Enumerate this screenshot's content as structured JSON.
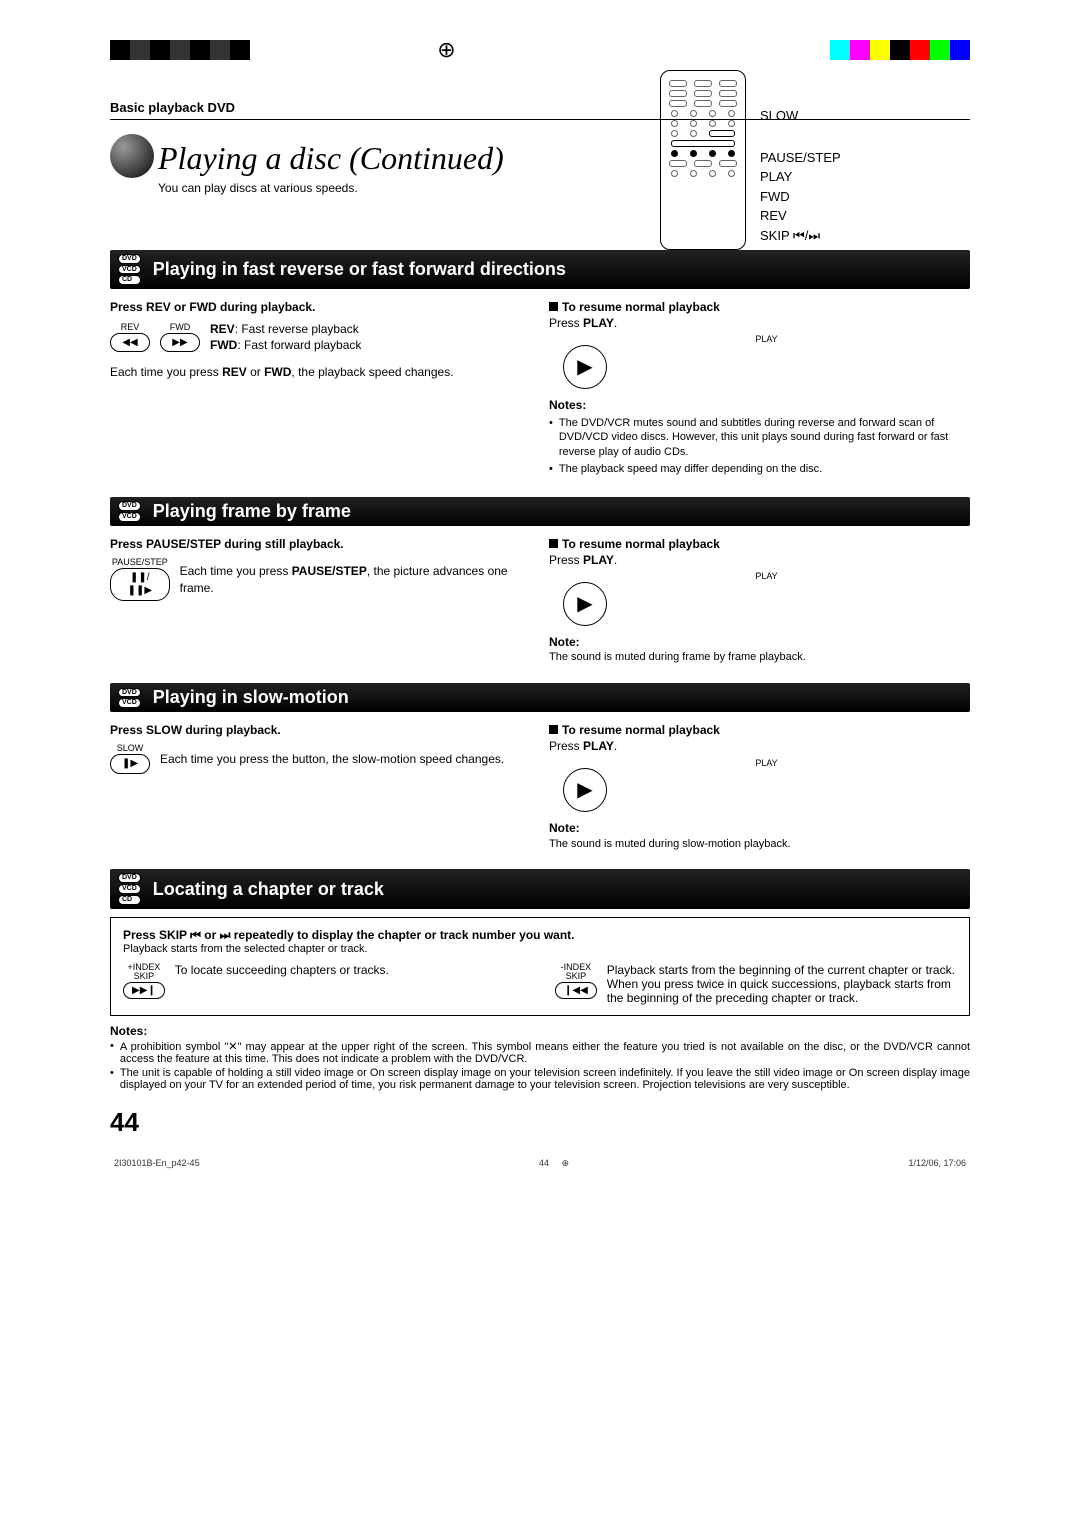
{
  "header": {
    "chapter": "Basic playback DVD"
  },
  "title": "Playing a disc (Continued)",
  "subtitle": "You can play discs at various speeds.",
  "remote": {
    "labels": [
      "SLOW",
      "PAUSE/STEP",
      "PLAY",
      "FWD",
      "REV",
      "SKIP ⏮/⏭"
    ]
  },
  "sections": [
    {
      "badges": [
        "DVD",
        "VCD",
        "CD"
      ],
      "heading": "Playing in fast reverse or fast forward directions",
      "left": {
        "step": "Press REV or FWD during playback.",
        "btns": [
          {
            "label": "REV",
            "glyph": "◀◀"
          },
          {
            "label": "FWD",
            "glyph": "▶▶"
          }
        ],
        "desc_lines": [
          {
            "b": "REV",
            "t": ":  Fast reverse playback"
          },
          {
            "b": "FWD",
            "t": ":  Fast forward playback"
          }
        ],
        "tail": "Each time you press REV or FWD, the playback speed changes."
      },
      "right": {
        "resume_head": "To resume normal playback",
        "resume_body": "Press PLAY.",
        "play_label": "PLAY",
        "play_glyph": "▶",
        "notes_title": "Notes:",
        "notes": [
          "The DVD/VCR mutes sound and subtitles during reverse and forward scan of DVD/VCD video discs. However, this unit plays sound during fast forward or fast reverse play of audio CDs.",
          "The playback speed may differ depending on the disc."
        ]
      }
    },
    {
      "badges": [
        "DVD",
        "VCD"
      ],
      "heading": "Playing frame by frame",
      "left": {
        "step": "Press PAUSE/STEP during still playback.",
        "btns": [
          {
            "label": "PAUSE/STEP",
            "glyph": "❚❚/❚❚▶"
          }
        ],
        "tail": "Each time you press PAUSE/STEP, the picture advances one frame."
      },
      "right": {
        "resume_head": "To resume normal playback",
        "resume_body": "Press PLAY.",
        "play_label": "PLAY",
        "play_glyph": "▶",
        "notes_title": "Note:",
        "note_single": "The sound is muted during frame by frame playback."
      }
    },
    {
      "badges": [
        "DVD",
        "VCD"
      ],
      "heading": "Playing in slow-motion",
      "left": {
        "step": "Press SLOW during playback.",
        "btns": [
          {
            "label": "SLOW",
            "glyph": "❚▶"
          }
        ],
        "tail": "Each time you press the button, the slow-motion speed changes."
      },
      "right": {
        "resume_head": "To resume normal playback",
        "resume_body": "Press PLAY.",
        "play_label": "PLAY",
        "play_glyph": "▶",
        "notes_title": "Note:",
        "note_single": "The sound is muted during slow-motion playback."
      }
    },
    {
      "badges": [
        "DVD",
        "VCD",
        "CD"
      ],
      "heading": "Locating a chapter or track",
      "box": {
        "instr": "Press SKIP ⏮ or ⏭ repeatedly to display the chapter or track number you want.",
        "sub": "Playback starts from the selected chapter or track.",
        "skip_fwd": {
          "label": "+INDEX\nSKIP",
          "glyph": "▶▶❙",
          "text": "To locate succeeding chapters or tracks."
        },
        "skip_rev": {
          "label": "-INDEX\nSKIP",
          "glyph": "❙◀◀",
          "text": "Playback starts from the beginning of the current chapter or track.\nWhen you press twice in quick successions, playback starts from the beginning of the preceding chapter or track."
        }
      },
      "notes_title": "Notes:",
      "notes": [
        "A prohibition symbol \"✕\" may appear at the upper right of the screen. This symbol means either the feature you tried is not available on the disc, or the DVD/VCR cannot access the feature at this time. This does not indicate a problem with the DVD/VCR.",
        "The unit is capable of holding a still video image or On screen display image on your television screen indefinitely. If you leave the still video image or On screen display image displayed on your TV for an extended period of time, you risk permanent damage to your television screen. Projection televisions are very susceptible."
      ]
    }
  ],
  "page_number": "44",
  "footer": {
    "file": "2I30101B-En_p42-45",
    "pg": "44",
    "date": "1/12/06, 17:06"
  }
}
